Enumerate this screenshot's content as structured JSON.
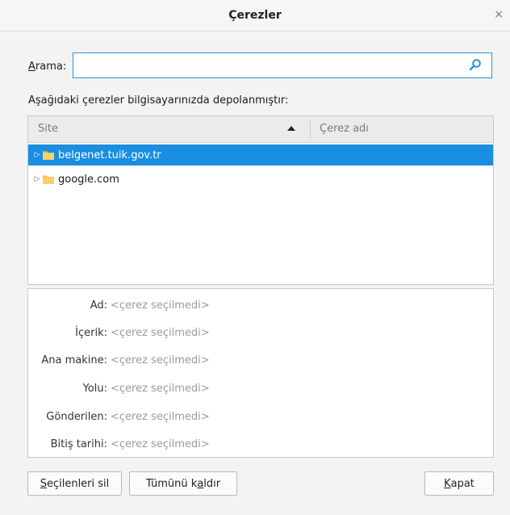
{
  "window": {
    "title": "Çerezler",
    "close_glyph": "×"
  },
  "search": {
    "label_first": "A",
    "label_rest": "rama:",
    "value": "",
    "placeholder": ""
  },
  "description": "Aşağıdaki çerezler bilgisayarınızda depolanmıştır:",
  "tree": {
    "columns": {
      "site": "Site",
      "name": "Çerez adı"
    },
    "rows": [
      {
        "site": "belgenet.tuik.gov.tr",
        "selected": true
      },
      {
        "site": "google.com",
        "selected": false
      }
    ]
  },
  "details": {
    "placeholder": "<çerez seçilmedi>",
    "fields": [
      {
        "label": "Ad:",
        "value": "<çerez seçilmedi>"
      },
      {
        "label": "İçerik:",
        "value": "<çerez seçilmedi>"
      },
      {
        "label": "Ana makine:",
        "value": "<çerez seçilmedi>"
      },
      {
        "label": "Yolu:",
        "value": "<çerez seçilmedi>"
      },
      {
        "label": "Gönderilen:",
        "value": "<çerez seçilmedi>"
      },
      {
        "label": "Bitiş tarihi:",
        "value": "<çerez seçilmedi>"
      }
    ]
  },
  "buttons": {
    "remove_selected": {
      "first": "S",
      "rest": "eçilenleri sil"
    },
    "remove_all": {
      "before": "Tümünü k",
      "accel": "a",
      "after": "ldır"
    },
    "close": {
      "first": "K",
      "rest": "apat"
    }
  },
  "colors": {
    "selection": "#1a8ee0",
    "focus_border": "#2f8fdd",
    "folder": "#f5c445"
  }
}
